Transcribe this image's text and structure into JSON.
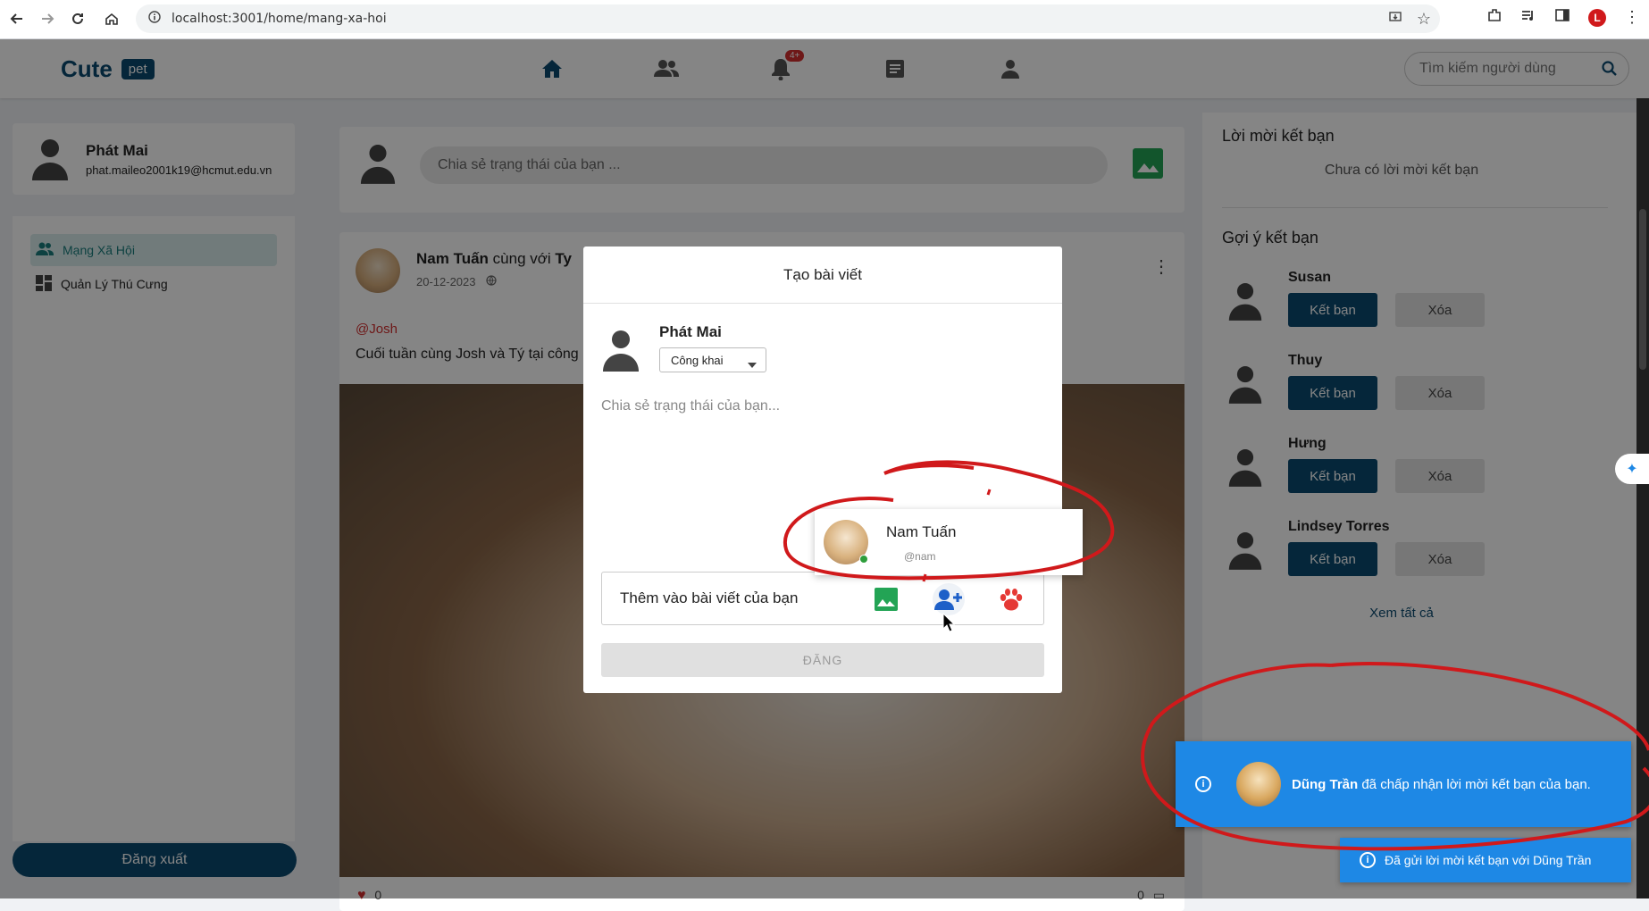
{
  "browser": {
    "url": "localhost:3001/home/mang-xa-hoi",
    "profile_letter": "L"
  },
  "header": {
    "logo_text": "Cute",
    "logo_badge": "pet",
    "notif_badge": "4+",
    "search_placeholder": "Tìm kiếm người dùng"
  },
  "left_sidebar": {
    "user_name": "Phát Mai",
    "user_email": "phat.maileo2001k19@hcmut.edu.vn",
    "menu": [
      {
        "label": "Mạng Xã Hội"
      },
      {
        "label": "Quản Lý Thú Cưng"
      }
    ],
    "logout_label": "Đăng xuất"
  },
  "composer": {
    "placeholder": "Chia sẻ trạng thái của bạn ..."
  },
  "post": {
    "author": "Nam Tuấn",
    "with_text": "cùng với",
    "with_name": "Ty",
    "date": "20-12-2023",
    "mention": "@Josh",
    "text": "Cuối tuần cùng Josh và Tý tại công",
    "likes": "0",
    "comments": "0"
  },
  "right_sidebar": {
    "requests_title": "Lời mời kết bạn",
    "requests_empty": "Chưa có lời mời kết bạn",
    "suggest_title": "Gợi ý kết bạn",
    "suggestions": [
      {
        "name": "Susan"
      },
      {
        "name": "Thuy"
      },
      {
        "name": "Hưng"
      },
      {
        "name": "Lindsey Torres"
      }
    ],
    "add_label": "Kết bạn",
    "delete_label": "Xóa",
    "see_all": "Xem tất cả"
  },
  "modal": {
    "title": "Tạo bài viết",
    "user_name": "Phát Mai",
    "privacy": "Công khai",
    "placeholder": "Chia sẻ trạng thái của bạn...",
    "add_to_post": "Thêm vào bài viết của bạn",
    "post_button": "ĐĂNG"
  },
  "tag_popup": {
    "name": "Nam Tuấn",
    "handle": "@nam"
  },
  "toasts": {
    "main_name": "Dũng Trần",
    "main_text": " đã chấp nhận lời mời kết bạn của bạn.",
    "small_text": "Đã gửi lời mời kết bạn với Dũng Trần"
  },
  "colors": {
    "brand": "#0b4a6f",
    "toast": "#1e88e5",
    "annotation": "#d0191b"
  }
}
